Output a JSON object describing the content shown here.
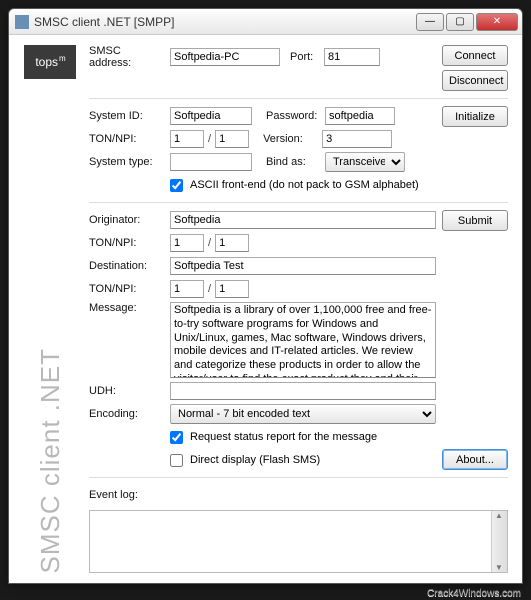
{
  "window": {
    "title": "SMSC client .NET [SMPP]"
  },
  "sidebar": {
    "logo_text": "tops",
    "logo_sup": "m",
    "vertical_text": "SMSC client .NET"
  },
  "conn": {
    "smsc_address_label": "SMSC address:",
    "smsc_address": "Softpedia-PC",
    "port_label": "Port:",
    "port": "81",
    "connect": "Connect",
    "disconnect": "Disconnect"
  },
  "auth": {
    "system_id_label": "System ID:",
    "system_id": "Softpedia",
    "password_label": "Password:",
    "password": "softpedia",
    "tonnpi_label": "TON/NPI:",
    "ton": "1",
    "npi": "1",
    "version_label": "Version:",
    "version": "3",
    "system_type_label": "System type:",
    "system_type": "",
    "bind_as_label": "Bind as:",
    "bind_as": "Transceiver",
    "ascii_label": "ASCII front-end (do not pack to GSM alphabet)",
    "initialize": "Initialize"
  },
  "msg": {
    "originator_label": "Originator:",
    "originator": "Softpedia",
    "tonnpi_label": "TON/NPI:",
    "orig_ton": "1",
    "orig_npi": "1",
    "destination_label": "Destination:",
    "destination": "Softpedia Test",
    "dest_ton": "1",
    "dest_npi": "1",
    "message_label": "Message:",
    "message": "Softpedia is a library of over 1,100,000 free and free-to-try software programs for Windows and Unix/Linux, games, Mac software, Windows drivers, mobile devices and IT-related articles. We review and categorize these products in order to allow the visitor/user to find the exact product they and their system needs. We strive to deliver only the best products to the visitor/user together with self-made",
    "udh_label": "UDH:",
    "udh": "",
    "encoding_label": "Encoding:",
    "encoding": "Normal - 7 bit encoded text",
    "status_report_label": "Request status report for the message",
    "direct_display_label": "Direct display (Flash SMS)",
    "submit": "Submit",
    "about": "About..."
  },
  "log": {
    "label": "Event log:"
  },
  "watermark": "Crack4Windows.com"
}
